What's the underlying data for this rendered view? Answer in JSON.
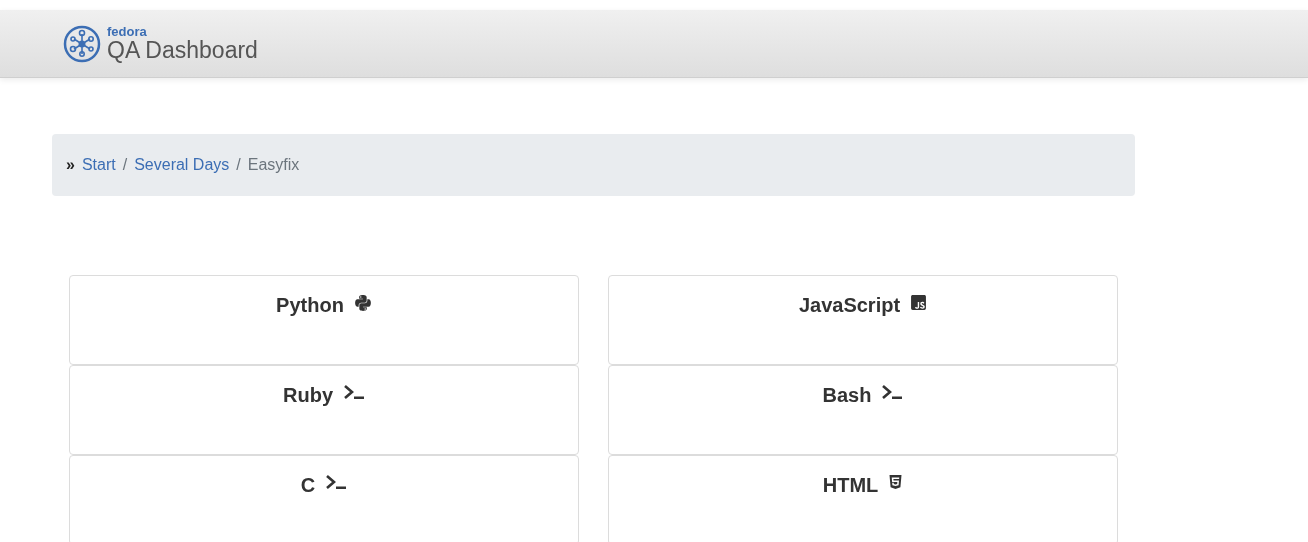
{
  "header": {
    "brand_small": "fedora",
    "brand_title": "QA Dashboard"
  },
  "breadcrumb": {
    "marker": "»",
    "separator": "/",
    "items": [
      {
        "label": "Start",
        "link": true
      },
      {
        "label": "Several Days",
        "link": true
      },
      {
        "label": "Easyfix",
        "link": false
      }
    ]
  },
  "cards": [
    {
      "title": "Python",
      "kind": "python"
    },
    {
      "title": "JavaScript",
      "kind": "javascript"
    },
    {
      "title": "Ruby",
      "kind": "terminal"
    },
    {
      "title": "Bash",
      "kind": "terminal"
    },
    {
      "title": "C",
      "kind": "terminal"
    },
    {
      "title": "HTML",
      "kind": "html"
    }
  ]
}
